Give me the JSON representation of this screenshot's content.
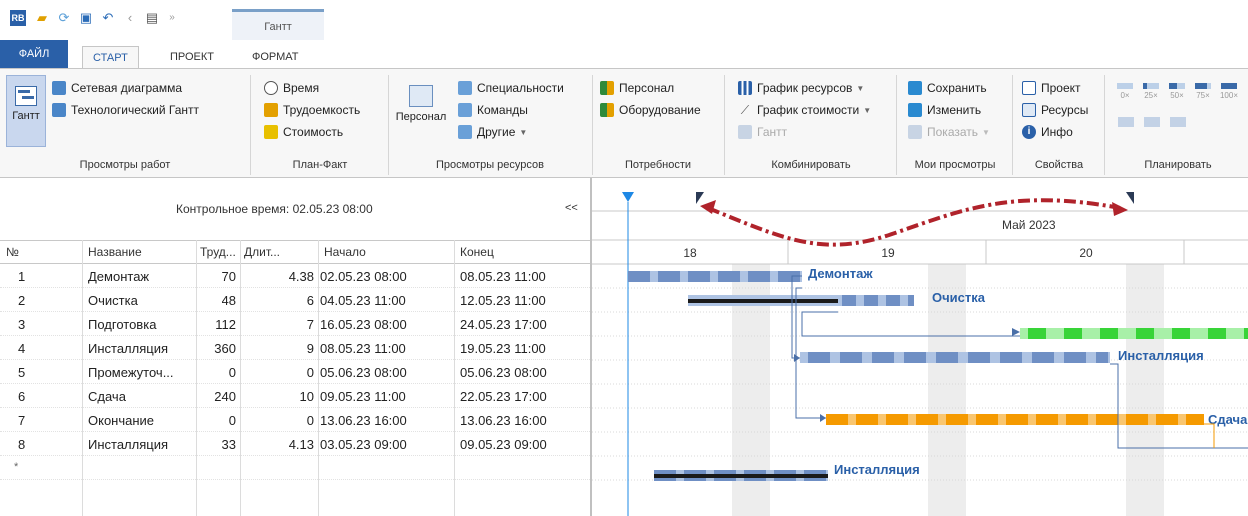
{
  "quick_access": {
    "contextual_tab": "Гантт"
  },
  "tabs": {
    "file": "ФАЙЛ",
    "start": "СТАРТ",
    "project": "ПРОЕКТ",
    "format": "ФОРМАТ"
  },
  "ribbon": {
    "work_views": {
      "gantt": "Гантт",
      "network": "Сетевая диаграмма",
      "tech_gantt": "Технологический Гантт",
      "label": "Просмотры работ"
    },
    "plan_fact": {
      "time": "Время",
      "labor": "Трудоемкость",
      "cost": "Стоимость",
      "label": "План-Факт"
    },
    "resource_views": {
      "staff": "Персонал",
      "specialties": "Специальности",
      "teams": "Команды",
      "others": "Другие",
      "label": "Просмотры ресурсов"
    },
    "needs": {
      "staff": "Персонал",
      "equipment": "Оборудование",
      "label": "Потребности"
    },
    "combine": {
      "res_chart": "График ресурсов",
      "cost_chart": "График стоимости",
      "gantt": "Гантт",
      "label": "Комбинировать"
    },
    "my_views": {
      "save": "Сохранить",
      "edit": "Изменить",
      "show": "Показать",
      "label": "Мои просмотры"
    },
    "properties": {
      "project": "Проект",
      "resources": "Ресурсы",
      "info": "Инфо",
      "label": "Свойства"
    },
    "plan": {
      "percents": [
        "0×",
        "25×",
        "50×",
        "75×",
        "100×"
      ],
      "label": "Планировать"
    }
  },
  "grid": {
    "control_time": "Контрольное время: 02.05.23 08:00",
    "collapse": "<<",
    "headers": {
      "num": "№",
      "name": "Название",
      "labor": "Труд...",
      "duration": "Длит...",
      "start": "Начало",
      "end": "Конец"
    },
    "rows": [
      {
        "num": "1",
        "name": "Демонтаж",
        "labor": "70",
        "duration": "4.38",
        "start": "02.05.23 08:00",
        "end": "08.05.23 11:00"
      },
      {
        "num": "2",
        "name": "Очистка",
        "labor": "48",
        "duration": "6",
        "start": "04.05.23 11:00",
        "end": "12.05.23 11:00"
      },
      {
        "num": "3",
        "name": "Подготовка",
        "labor": "112",
        "duration": "7",
        "start": "16.05.23 08:00",
        "end": "24.05.23 17:00"
      },
      {
        "num": "4",
        "name": "Инсталляция",
        "labor": "360",
        "duration": "9",
        "start": "08.05.23 11:00",
        "end": "19.05.23 11:00"
      },
      {
        "num": "5",
        "name": "Промежуточ...",
        "labor": "0",
        "duration": "0",
        "start": "05.06.23 08:00",
        "end": "05.06.23 08:00"
      },
      {
        "num": "6",
        "name": "Сдача",
        "labor": "240",
        "duration": "10",
        "start": "09.05.23 11:00",
        "end": "22.05.23 17:00"
      },
      {
        "num": "7",
        "name": "Окончание",
        "labor": "0",
        "duration": "0",
        "start": "13.06.23 16:00",
        "end": "13.06.23 16:00"
      },
      {
        "num": "8",
        "name": "Инсталляция",
        "labor": "33",
        "duration": "4.13",
        "start": "03.05.23 09:00",
        "end": "09.05.23 09:00"
      }
    ],
    "new_row": "*"
  },
  "gantt": {
    "month": "Май 2023",
    "weeks": [
      "18",
      "19",
      "20"
    ],
    "bar_labels": [
      "Демонтаж",
      "Очистка",
      "Инсталляция",
      "Сдача",
      "Инсталляция"
    ],
    "colors": {
      "blue": "#6f8fc4",
      "dark": "#1a1a1a",
      "green": "#38d438",
      "orange": "#f59a00",
      "red_arrow": "#b0232b",
      "marker": "#1e88e5"
    }
  }
}
